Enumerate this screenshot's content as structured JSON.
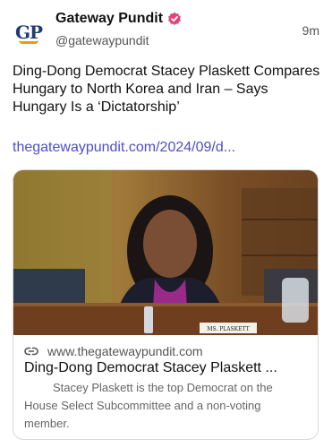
{
  "author": {
    "name": "Gateway Pundit",
    "handle": "@gatewaypundit",
    "avatar_text": "GP",
    "verified_color": "#e0457b"
  },
  "timestamp": "9m",
  "post": {
    "text": "Ding-Dong Democrat Stacey Plaskett Compares Hungary to North Korea and Iran – Says Hungary Is a ‘Dictatorship’",
    "link": "thegatewaypundit.com/2024/09/d..."
  },
  "link_card": {
    "domain": "www.thegatewaypundit.com",
    "title": "Ding-Dong Democrat Stacey Plaskett ...",
    "description": "Stacey Plaskett is the top Democrat on the House Select Subcommittee and a non-voting member.",
    "nameplate": "MS. PLASKETT"
  },
  "colors": {
    "link": "#4a4fc9",
    "avatar_text": "#1f3b73",
    "avatar_accent": "#e89c1a"
  },
  "icons": [
    "verified-badge-icon",
    "link-icon"
  ]
}
